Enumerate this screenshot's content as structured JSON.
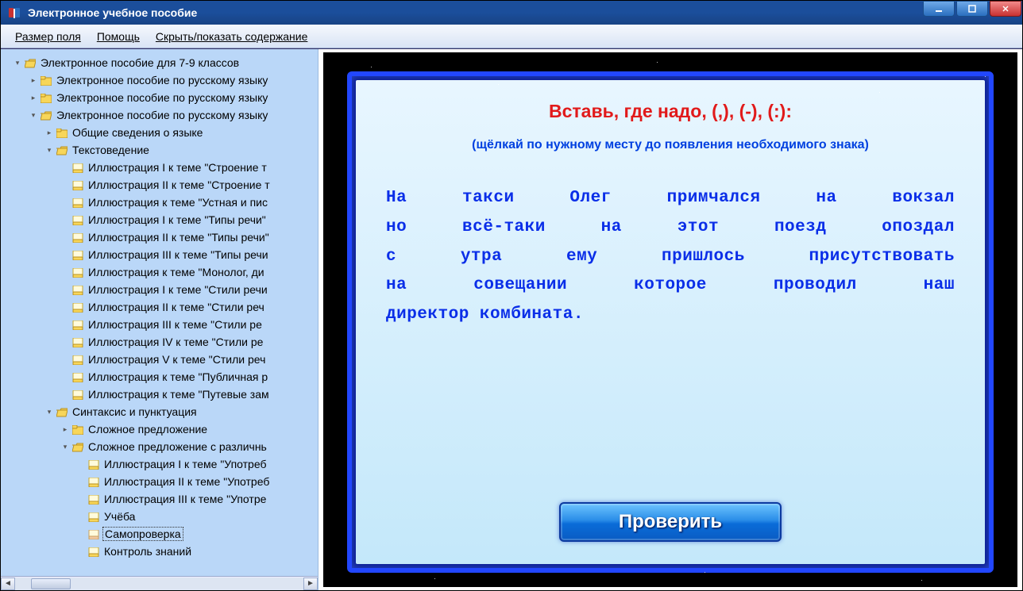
{
  "window": {
    "title": "Электронное учебное пособие"
  },
  "menu": {
    "field_size": "Размер поля",
    "help": "Помощь",
    "toggle_contents": "Скрыть/показать содержание"
  },
  "tree": {
    "root": "Электронное пособие для 7-9 классов",
    "rus7": "Электронное пособие по русскому языку",
    "rus8": "Электронное пособие по русскому языку",
    "rus9": "Электронное пособие по русскому языку",
    "general": "Общие сведения о языке",
    "text": "Текстоведение",
    "text_items": [
      "Иллюстрация I к теме \"Строение т",
      "Иллюстрация II к теме \"Строение т",
      "Иллюстрация к теме \"Устная и пис",
      "Иллюстрация I к теме \"Типы речи\"",
      "Иллюстрация II к теме \"Типы речи\"",
      "Иллюстрация III к теме \"Типы речи",
      "Иллюстрация к теме \"Монолог, ди",
      "Иллюстрация I к теме \"Стили речи",
      "Иллюстрация II к теме \"Стили реч",
      "Иллюстрация III к теме \"Стили ре",
      "Иллюстрация IV к теме \"Стили ре",
      "Иллюстрация V к теме \"Стили реч",
      "Иллюстрация к теме \"Публичная р",
      "Иллюстрация к теме \"Путевые зам"
    ],
    "syntax": "Синтаксис и пунктуация",
    "complex": "Сложное предложение",
    "complex_var": "Сложное предложение с различнь",
    "complex_items": [
      "Иллюстрация I к теме \"Употреб",
      "Иллюстрация II к теме \"Употреб",
      "Иллюстрация III к теме \"Употре",
      "Учёба",
      "Самопроверка",
      "Контроль знаний"
    ],
    "selected_index": 4
  },
  "task": {
    "title": "Вставь, где надо, (,), (-), (:):",
    "hint": "(щёлкай по нужному месту до появления необходимого знака)",
    "body_lines": [
      "На такси Олег примчался на вокзал",
      "но всё-таки на этот поезд опоздал",
      "с утра ему пришлось присутствовать",
      "на совещании которое проводил наш",
      "директор комбината."
    ],
    "check_label": "Проверить"
  }
}
